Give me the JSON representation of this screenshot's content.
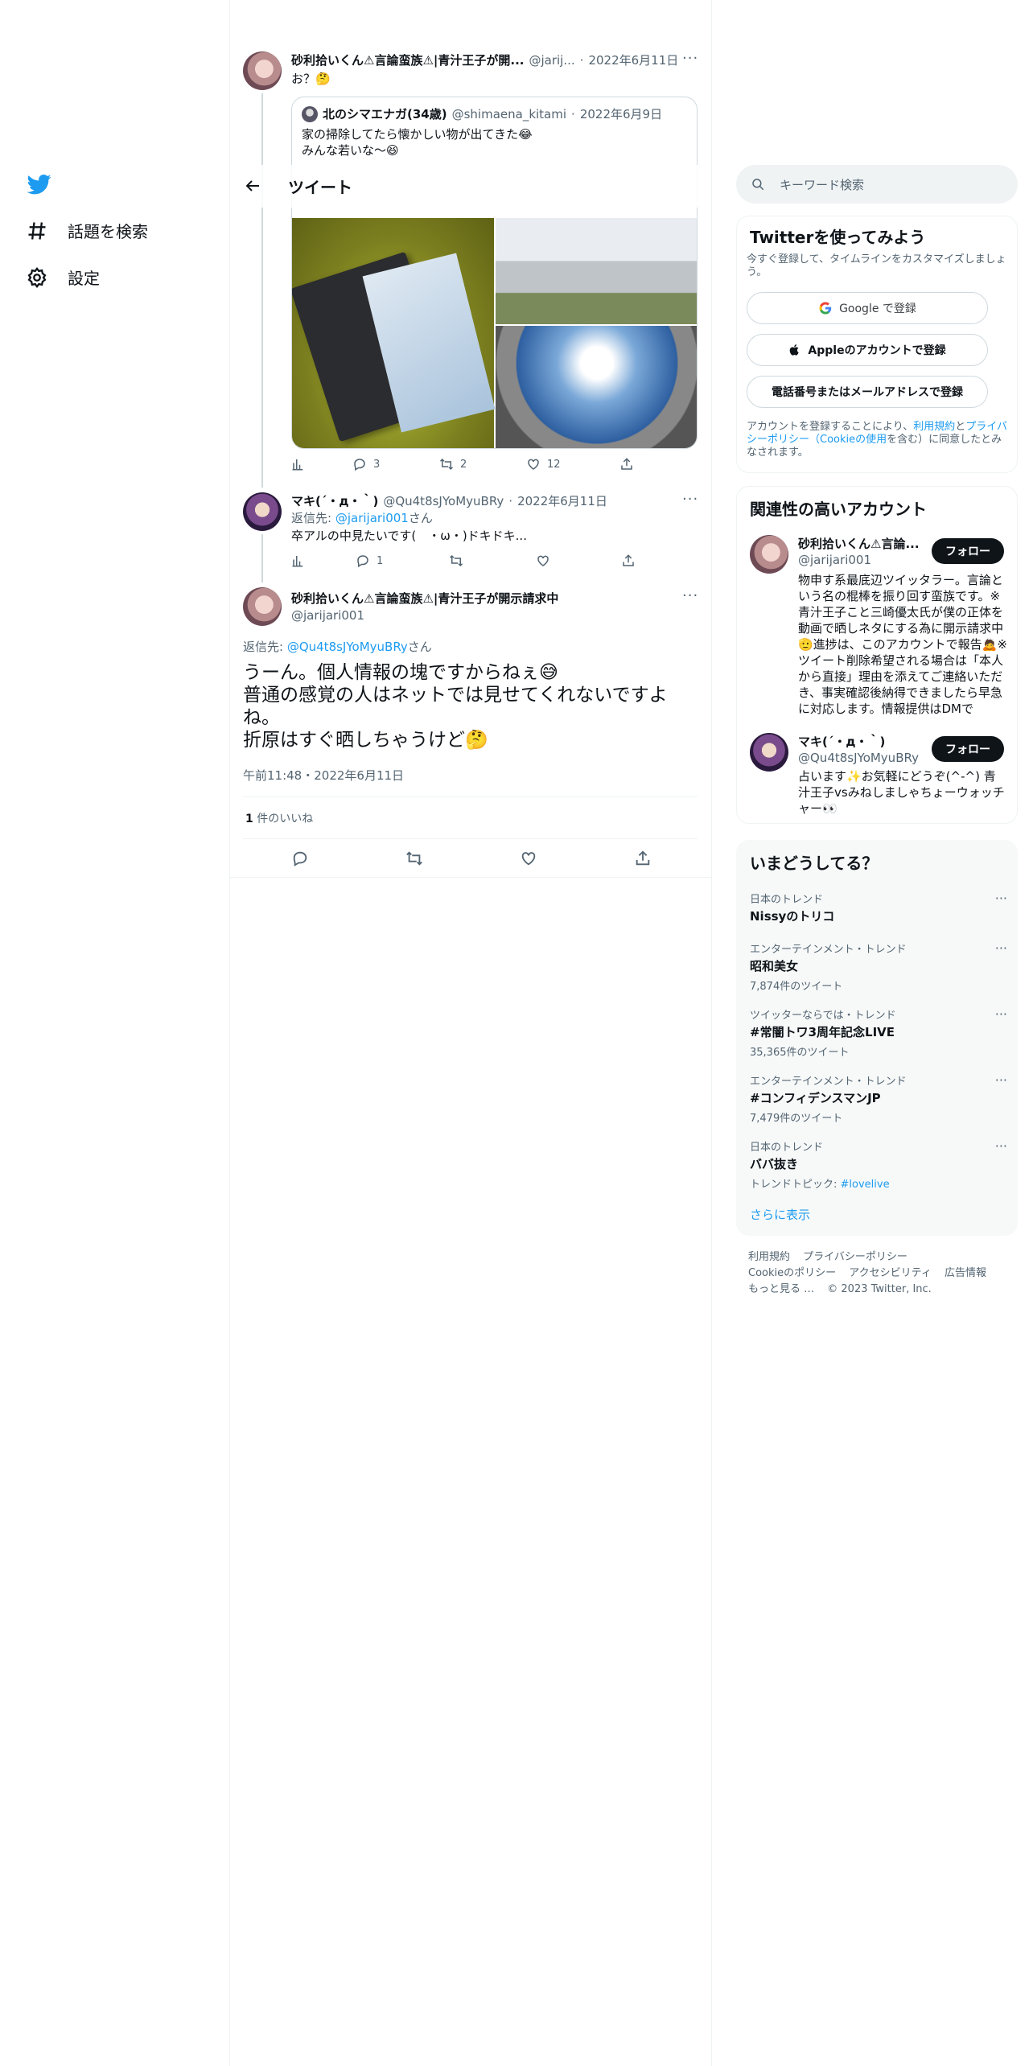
{
  "nav": {
    "items": [
      {
        "label": "話題を検索",
        "icon": "hashtag-icon"
      },
      {
        "label": "設定",
        "icon": "gear-icon"
      }
    ]
  },
  "header": {
    "title": "ツイート"
  },
  "tweets": [
    {
      "name": "砂利拾いくん⚠言論蛮族⚠|青汁王子が開...",
      "handle": "@jarij...",
      "time": "2022年6月11日",
      "text": "お？🤔",
      "quote": {
        "name": "北のシマエナガ(34歳)",
        "handle": "@shimaena_kitami",
        "time": "2022年6月9日",
        "line1": "家の掃除してたら懐かしい物が出てきた😂",
        "line2": "みんな若いな〜😆"
      },
      "replies": "3",
      "retweets": "2",
      "likes": "12"
    },
    {
      "name": "マキ(´・д・｀)",
      "handle": "@Qu4t8sJYoMyuBRy",
      "time": "2022年6月11日",
      "reply_to_prefix": "返信先: ",
      "reply_to": "@jarijari001",
      "reply_to_suffix": "さん",
      "text": "卒アルの中見たいです(　・ω・)ドキドキ...",
      "replies": "1"
    }
  ],
  "focused": {
    "name": "砂利拾いくん⚠言論蛮族⚠|青汁王子が開示請求中",
    "handle": "@jarijari001",
    "reply_to_prefix": "返信先: ",
    "reply_to": "@Qu4t8sJYoMyuBRy",
    "reply_to_suffix": "さん",
    "line1": "うーん。個人情報の塊ですからねぇ😅",
    "line2": "普通の感覚の人はネットでは見せてくれないですよね。",
    "line3": "折原はすぐ晒しちゃうけど🤔",
    "timestamp": "午前11:48・2022年6月11日",
    "likes_count": "1",
    "likes_label": "件のいいね"
  },
  "search": {
    "placeholder": "キーワード検索"
  },
  "signup": {
    "title": "Twitterを使ってみよう",
    "subtitle": "今すぐ登録して、タイムラインをカスタマイズしましょう。",
    "google": "Google で登録",
    "apple": "Appleのアカウントで登録",
    "phone": "電話番号またはメールアドレスで登録",
    "legal_prefix": "アカウントを登録することにより、",
    "terms": "利用規約",
    "and": "と",
    "privacy": "プライバシーポリシー（Cookieの使用",
    "legal_suffix": "を含む）に同意したとみなされます。"
  },
  "related": {
    "title": "関連性の高いアカウント",
    "follow": "フォロー",
    "accounts": [
      {
        "name": "砂利拾いくん⚠言論...",
        "handle": "@jarijari001",
        "bio": "物申す系最底辺ツイッタラー。言論という名の棍棒を振り回す蛮族です。※青汁王子こと三崎優太氏が僕の正体を動画で晒しネタにする為に開示請求中🫡進捗は、このアカウントで報告🙇※ツイート削除希望される場合は「本人から直接」理由を添えてご連絡いただき、事実確認後納得できましたら早急に対応します。情報提供はDMで"
      },
      {
        "name": "マキ(´・д・｀)",
        "handle": "@Qu4t8sJYoMyuBRy",
        "bio": "占います✨お気軽にどうぞ(^-^) 青汁王子vsみねしましゃちょーウォッチャー👀"
      }
    ]
  },
  "trends": {
    "title": "いまどうしてる？",
    "items": [
      {
        "category": "日本のトレンド",
        "name": "Nissyのトリコ",
        "count": ""
      },
      {
        "category": "エンターテインメント・トレンド",
        "name": "昭和美女",
        "count": "7,874件のツイート"
      },
      {
        "category": "ツイッターならでは・トレンド",
        "name": "#常闇トワ3周年記念LIVE",
        "count": "35,365件のツイート"
      },
      {
        "category": "エンターテインメント・トレンド",
        "name": "#コンフィデンスマンJP",
        "count": "7,479件のツイート"
      },
      {
        "category": "日本のトレンド",
        "name": "ババ抜き",
        "count_prefix": "トレンドトピック: ",
        "count_link": "#lovelive"
      }
    ],
    "show_more": "さらに表示"
  },
  "footer": {
    "links": [
      "利用規約",
      "プライバシーポリシー",
      "Cookieのポリシー",
      "アクセシビリティ",
      "広告情報",
      "もっと見る …"
    ],
    "copyright": "© 2023 Twitter, Inc."
  },
  "colors": {
    "accent": "#1d9bf0",
    "text": "#0f1419",
    "muted": "#536471"
  }
}
